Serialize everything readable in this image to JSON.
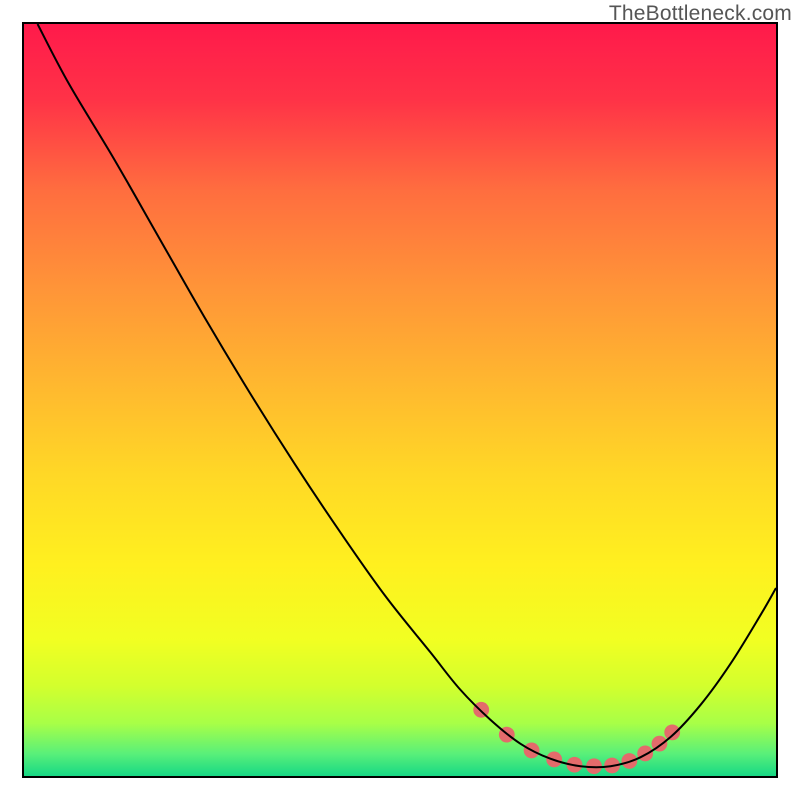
{
  "watermark": "TheBottleneck.com",
  "chart_data": {
    "type": "line",
    "title": "",
    "xlabel": "",
    "ylabel": "",
    "x_range": [
      0,
      100
    ],
    "y_range": [
      0,
      100
    ],
    "grid": false,
    "legend": false,
    "series": [
      {
        "name": "curve",
        "color": "#000000",
        "stroke_width": 2,
        "points": [
          {
            "x": 1.8,
            "y": 100
          },
          {
            "x": 6.0,
            "y": 92.0
          },
          {
            "x": 12.0,
            "y": 82.0
          },
          {
            "x": 18.0,
            "y": 71.5
          },
          {
            "x": 24.0,
            "y": 61.0
          },
          {
            "x": 30.0,
            "y": 51.0
          },
          {
            "x": 36.0,
            "y": 41.5
          },
          {
            "x": 42.0,
            "y": 32.5
          },
          {
            "x": 48.0,
            "y": 24.0
          },
          {
            "x": 54.0,
            "y": 16.5
          },
          {
            "x": 58.0,
            "y": 11.5
          },
          {
            "x": 62.0,
            "y": 7.5
          },
          {
            "x": 66.0,
            "y": 4.3
          },
          {
            "x": 70.0,
            "y": 2.3
          },
          {
            "x": 74.0,
            "y": 1.3
          },
          {
            "x": 78.0,
            "y": 1.3
          },
          {
            "x": 82.0,
            "y": 2.5
          },
          {
            "x": 86.0,
            "y": 5.2
          },
          {
            "x": 90.0,
            "y": 9.5
          },
          {
            "x": 94.0,
            "y": 15.0
          },
          {
            "x": 98.0,
            "y": 21.5
          },
          {
            "x": 100.0,
            "y": 25.0
          }
        ]
      },
      {
        "name": "highlight-dots",
        "color": "#e36b6b",
        "marker_radius": 8,
        "points": [
          {
            "x": 60.8,
            "y": 8.8
          },
          {
            "x": 64.2,
            "y": 5.5
          },
          {
            "x": 67.5,
            "y": 3.4
          },
          {
            "x": 70.5,
            "y": 2.2
          },
          {
            "x": 73.2,
            "y": 1.5
          },
          {
            "x": 75.8,
            "y": 1.3
          },
          {
            "x": 78.2,
            "y": 1.4
          },
          {
            "x": 80.5,
            "y": 2.0
          },
          {
            "x": 82.6,
            "y": 3.0
          },
          {
            "x": 84.5,
            "y": 4.3
          },
          {
            "x": 86.2,
            "y": 5.8
          }
        ]
      }
    ],
    "background_gradient": {
      "stops": [
        {
          "offset": 0.0,
          "color": "#ff1a4b"
        },
        {
          "offset": 0.1,
          "color": "#ff3247"
        },
        {
          "offset": 0.22,
          "color": "#ff6d3f"
        },
        {
          "offset": 0.35,
          "color": "#ff9438"
        },
        {
          "offset": 0.48,
          "color": "#ffb82f"
        },
        {
          "offset": 0.6,
          "color": "#ffd826"
        },
        {
          "offset": 0.72,
          "color": "#fff01f"
        },
        {
          "offset": 0.82,
          "color": "#f1ff22"
        },
        {
          "offset": 0.88,
          "color": "#d3ff2d"
        },
        {
          "offset": 0.93,
          "color": "#a8ff47"
        },
        {
          "offset": 0.97,
          "color": "#5af079"
        },
        {
          "offset": 1.0,
          "color": "#17d885"
        }
      ]
    }
  }
}
